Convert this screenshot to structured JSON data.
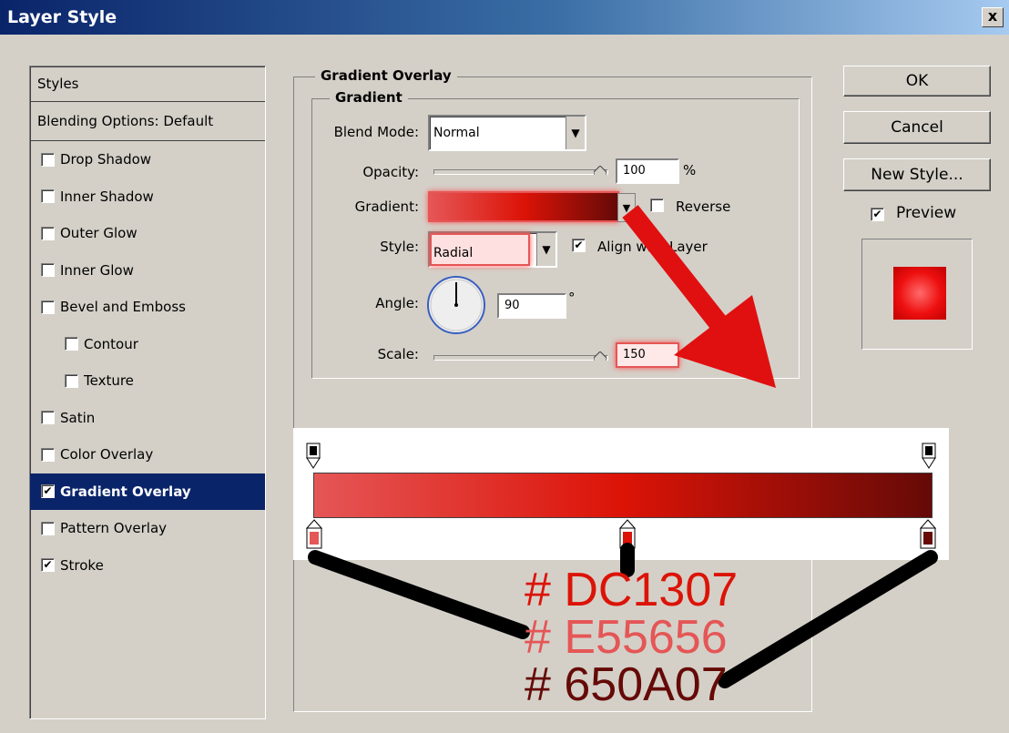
{
  "window": {
    "title": "Layer Style",
    "close_label": "x"
  },
  "styles_panel": {
    "header": "Styles",
    "blending": "Blending Options: Default",
    "items": [
      {
        "label": "Drop Shadow",
        "checked": false
      },
      {
        "label": "Inner Shadow",
        "checked": false
      },
      {
        "label": "Outer Glow",
        "checked": false
      },
      {
        "label": "Inner Glow",
        "checked": false
      },
      {
        "label": "Bevel and Emboss",
        "checked": false
      },
      {
        "label": "Contour",
        "checked": false
      },
      {
        "label": "Texture",
        "checked": false
      },
      {
        "label": "Satin",
        "checked": false
      },
      {
        "label": "Color Overlay",
        "checked": false
      },
      {
        "label": "Gradient Overlay",
        "checked": true
      },
      {
        "label": "Pattern Overlay",
        "checked": false
      },
      {
        "label": "Stroke",
        "checked": true
      }
    ]
  },
  "gradient_overlay": {
    "section_title": "Gradient Overlay",
    "group_title": "Gradient",
    "blend_mode": {
      "label": "Blend Mode:",
      "value": "Normal"
    },
    "opacity": {
      "label": "Opacity:",
      "value": "100",
      "unit": "%"
    },
    "gradient": {
      "label": "Gradient:",
      "reverse_label": "Reverse",
      "reverse_checked": false
    },
    "style": {
      "label": "Style:",
      "value": "Radial",
      "align_label": "Align with Layer",
      "align_checked": true
    },
    "angle": {
      "label": "Angle:",
      "value": "90",
      "unit": "°"
    },
    "scale": {
      "label": "Scale:",
      "value": "150",
      "unit": "%"
    }
  },
  "buttons": {
    "ok": "OK",
    "cancel": "Cancel",
    "new_style": "New Style...",
    "preview_label": "Preview",
    "preview_checked": true
  },
  "annotations": {
    "hex1": "# DC1307",
    "hex2": "# E55656",
    "hex3": "# 650A07",
    "colors": {
      "hex1": "#dc1307",
      "hex2": "#e55656",
      "hex3": "#650a07",
      "arrow": "#e01010"
    }
  }
}
